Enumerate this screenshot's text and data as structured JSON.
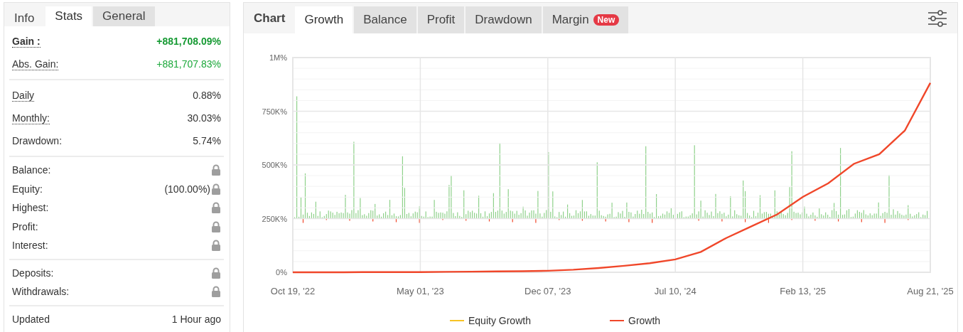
{
  "stats_panel": {
    "title": "Info",
    "tabs": [
      {
        "label": "Stats",
        "selected": true
      },
      {
        "label": "General",
        "selected": false
      }
    ],
    "groups": [
      {
        "rows": [
          {
            "label": "Gain :",
            "value": "+881,708.09%",
            "positive": true,
            "bold": true,
            "hint": true
          },
          {
            "label": "Abs. Gain:",
            "value": "+881,707.83%",
            "positive": true,
            "bold": false,
            "hint": true
          }
        ]
      },
      {
        "rows": [
          {
            "label": "Daily",
            "value": "0.88%",
            "positive": false,
            "bold": false,
            "hint": true
          },
          {
            "label": "Monthly:",
            "value": "30.03%",
            "positive": false,
            "bold": false,
            "hint": true
          },
          {
            "label": "Drawdown:",
            "value": "5.74%",
            "positive": false,
            "bold": false,
            "hint": false
          }
        ]
      },
      {
        "rows": [
          {
            "label": "Balance:",
            "locked": true
          },
          {
            "label": "Equity:",
            "value": "(100.00%)",
            "locked": true
          },
          {
            "label": "Highest:",
            "locked": true
          },
          {
            "label": "Profit:",
            "locked": true
          },
          {
            "label": "Interest:",
            "locked": true
          }
        ]
      },
      {
        "rows": [
          {
            "label": "Deposits:",
            "locked": true
          },
          {
            "label": "Withdrawals:",
            "locked": true
          }
        ]
      },
      {
        "rows": [
          {
            "label": "Updated",
            "value": "1 Hour ago",
            "positive": false,
            "bold": false,
            "hint": false
          }
        ]
      }
    ]
  },
  "chart_panel": {
    "title": "Chart",
    "tabs": [
      {
        "label": "Growth",
        "selected": true
      },
      {
        "label": "Balance",
        "selected": false
      },
      {
        "label": "Profit",
        "selected": false
      },
      {
        "label": "Drawdown",
        "selected": false
      },
      {
        "label": "Margin",
        "selected": false,
        "badge": "New"
      }
    ],
    "chart_data": {
      "type": "line",
      "categories": [
        "Oct 19, '22",
        null,
        null,
        null,
        null,
        "May 01, '23",
        null,
        null,
        null,
        null,
        "Dec 07, '23",
        null,
        null,
        null,
        null,
        "Jul 10, '24",
        null,
        null,
        null,
        null,
        "Feb 13, '25",
        null,
        null,
        null,
        null,
        "Aug 21, '25"
      ],
      "series": [
        {
          "name": "Equity Growth",
          "color": "#f7c325",
          "values": [
            null,
            null,
            null,
            null,
            null,
            null,
            null,
            null,
            null,
            null,
            null,
            null,
            null,
            null,
            null,
            null,
            null,
            null,
            null,
            null,
            null,
            null,
            null,
            null,
            null,
            null
          ]
        },
        {
          "name": "Growth",
          "color": "#f0472a",
          "values": [
            0,
            0,
            0,
            1000,
            1000,
            1000,
            2000,
            3000,
            4000,
            5000,
            7000,
            12000,
            20000,
            30000,
            42000,
            60000,
            95000,
            160000,
            215000,
            270000,
            351000,
            415000,
            505000,
            550000,
            660000,
            882000
          ]
        }
      ],
      "grid": true,
      "ylim": [
        0,
        1000000
      ],
      "yticks": [
        {
          "value": 0,
          "label": "0%"
        },
        {
          "value": 250000,
          "label": "250K%"
        },
        {
          "value": 500000,
          "label": "500K%"
        },
        {
          "value": 750000,
          "label": "750K%"
        },
        {
          "value": 1000000,
          "label": "1M%"
        }
      ]
    }
  }
}
